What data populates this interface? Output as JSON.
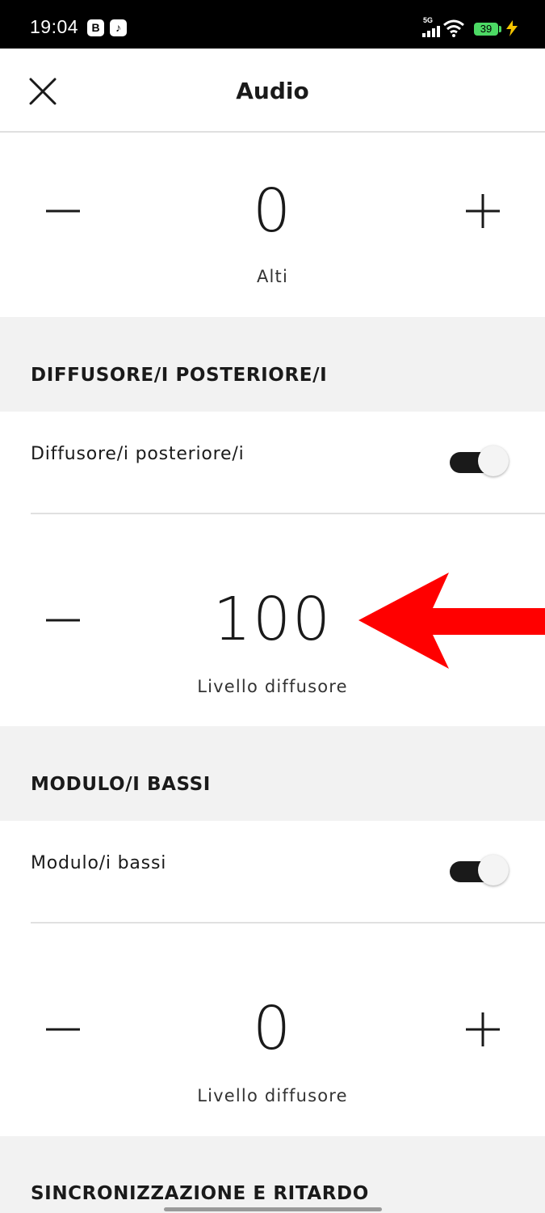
{
  "status_bar": {
    "time": "19:04",
    "app_badges": [
      "B",
      "♪"
    ],
    "network": "5G",
    "battery": "39"
  },
  "header": {
    "title": "Audio",
    "close_icon": "close-icon"
  },
  "treble": {
    "value": "0",
    "label": "Alti"
  },
  "rear_speakers": {
    "section_title": "DIFFUSORE/I POSTERIORE/I",
    "toggle_label": "Diffusore/i posteriore/i",
    "toggle_on": true,
    "level_value": "100",
    "level_label": "Livello diffusore"
  },
  "bass_module": {
    "section_title": "MODULO/I BASSI",
    "toggle_label": "Modulo/i bassi",
    "toggle_on": true,
    "level_value": "0",
    "level_label": "Livello diffusore"
  },
  "sync": {
    "section_title": "SINCRONIZZAZIONE E RITARDO"
  },
  "colors": {
    "arrow": "#ff0000",
    "toggle_track": "#1a1a1a",
    "section_bg": "#f2f2f2"
  }
}
